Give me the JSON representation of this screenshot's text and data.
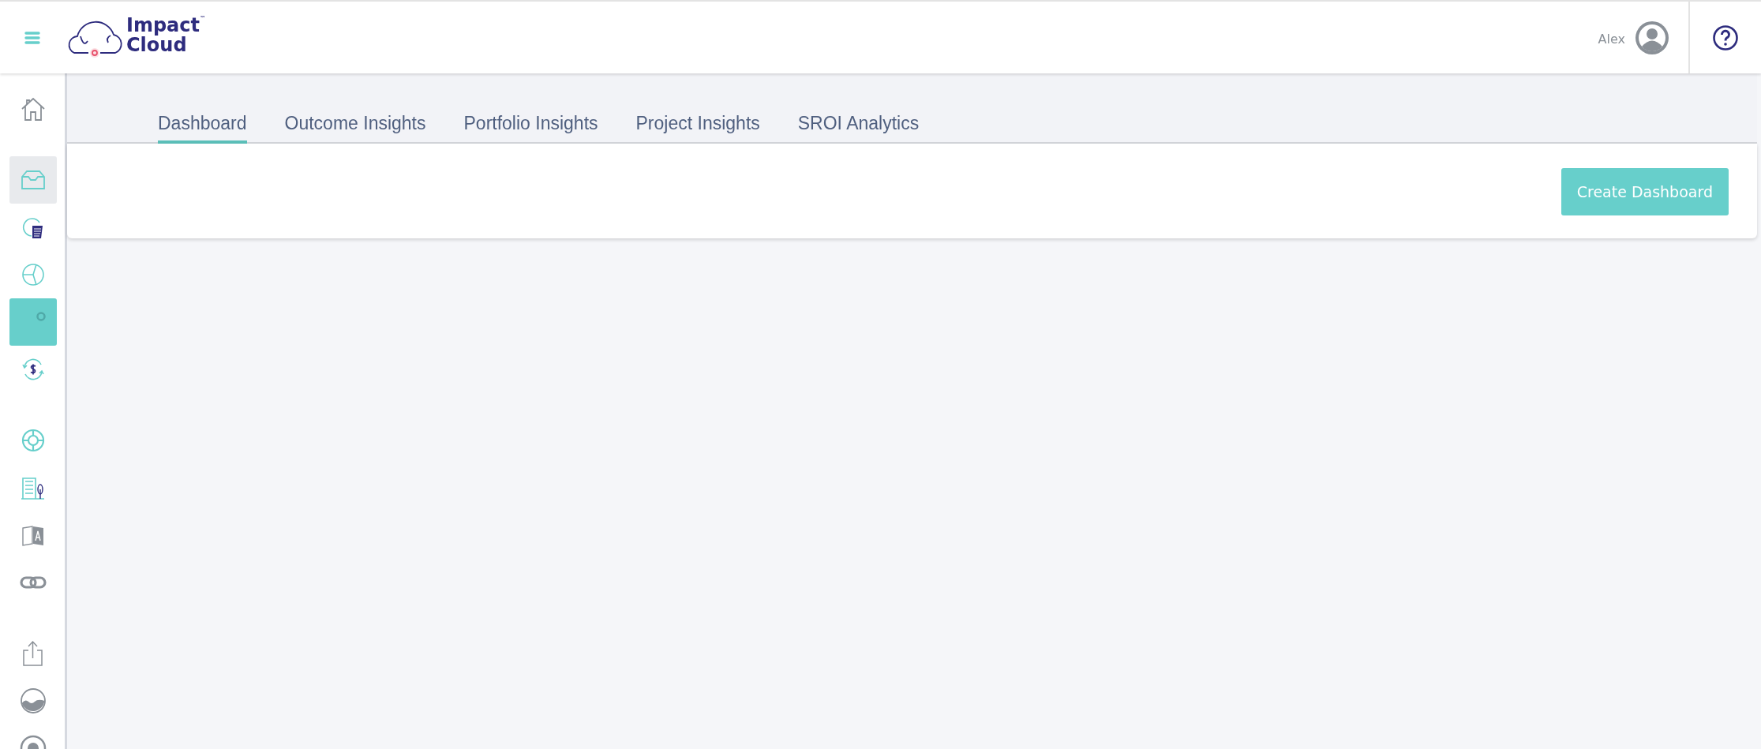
{
  "header": {
    "logo": {
      "line_1": "Impact",
      "line_2": "Cloud",
      "trademark": "™"
    },
    "user_name": "Alex"
  },
  "sidebar": {
    "groups": [
      [
        {
          "kind": "home",
          "selected": false,
          "highlighted": false
        }
      ],
      [
        {
          "kind": "inbox",
          "selected": false,
          "highlighted": true
        },
        {
          "kind": "pie-document",
          "selected": false,
          "highlighted": false
        },
        {
          "kind": "pie",
          "selected": false,
          "highlighted": false
        },
        {
          "kind": "dot",
          "selected": true,
          "highlighted": false
        },
        {
          "kind": "dollar-cycle",
          "selected": false,
          "highlighted": false
        }
      ],
      [
        {
          "kind": "lifebuoy",
          "selected": false,
          "highlighted": false
        },
        {
          "kind": "building",
          "selected": false,
          "highlighted": false
        },
        {
          "kind": "translate",
          "selected": false,
          "highlighted": false
        },
        {
          "kind": "link",
          "selected": false,
          "highlighted": false
        }
      ],
      [
        {
          "kind": "share",
          "selected": false,
          "highlighted": false
        },
        {
          "kind": "landscape",
          "selected": false,
          "highlighted": false
        },
        {
          "kind": "record",
          "selected": false,
          "highlighted": false
        }
      ]
    ]
  },
  "tabs": [
    {
      "label": "Dashboard",
      "selected": true
    },
    {
      "label": "Outcome Insights",
      "selected": false
    },
    {
      "label": "Portfolio Insights",
      "selected": false
    },
    {
      "label": "Project Insights",
      "selected": false
    },
    {
      "label": "SROI Analytics",
      "selected": false
    }
  ],
  "toolbar": {
    "create_button": "Create Dashboard"
  }
}
